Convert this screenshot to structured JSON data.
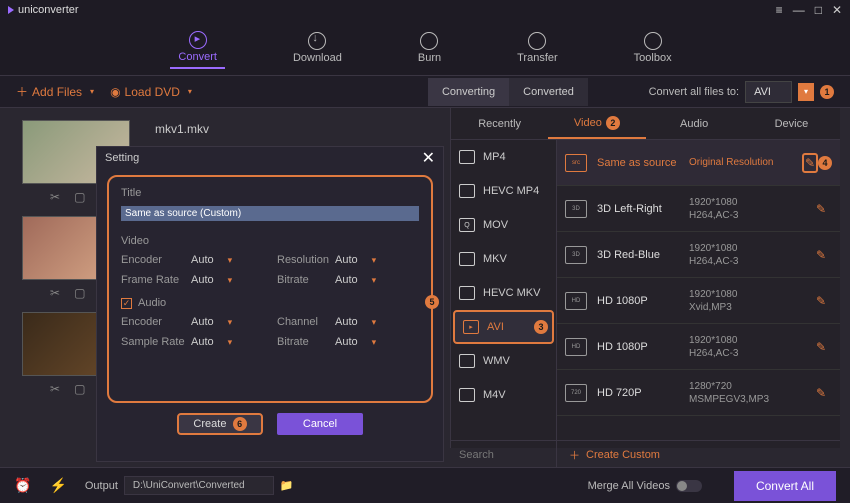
{
  "app": {
    "name": "uniconverter"
  },
  "window_controls": [
    "≡",
    "—",
    "□",
    "✕"
  ],
  "mainnav": [
    {
      "label": "Convert",
      "active": true
    },
    {
      "label": "Download",
      "active": false
    },
    {
      "label": "Burn",
      "active": false
    },
    {
      "label": "Transfer",
      "active": false
    },
    {
      "label": "Toolbox",
      "active": false
    }
  ],
  "toolbar": {
    "add_files": "Add Files",
    "load_dvd": "Load DVD",
    "tabs": {
      "converting": "Converting",
      "converted": "Converted"
    },
    "convert_all_label": "Convert all files to:",
    "format_value": "AVI"
  },
  "badges": {
    "b1": "1",
    "b2": "2",
    "b3": "3",
    "b4": "4",
    "b5": "5",
    "b6": "6"
  },
  "files": [
    {
      "name": "mkv1.mkv"
    }
  ],
  "setting": {
    "title": "Setting",
    "title_label": "Title",
    "title_value": "Same as source (Custom)",
    "video_label": "Video",
    "audio_label": "Audio",
    "fields": {
      "encoder": "Encoder",
      "resolution": "Resolution",
      "frame_rate": "Frame Rate",
      "bitrate": "Bitrate",
      "channel": "Channel",
      "sample_rate": "Sample Rate"
    },
    "auto": "Auto",
    "create": "Create",
    "cancel": "Cancel"
  },
  "format_panel": {
    "tabs": {
      "recently": "Recently",
      "video": "Video",
      "audio": "Audio",
      "device": "Device"
    },
    "formats": [
      "MP4",
      "HEVC MP4",
      "MOV",
      "MKV",
      "HEVC MKV",
      "AVI",
      "WMV",
      "M4V"
    ],
    "active_format": "AVI",
    "resolutions": [
      {
        "name": "Same as source",
        "res": "Original Resolution",
        "codec": "",
        "active": true
      },
      {
        "name": "3D Left-Right",
        "res": "1920*1080",
        "codec": "H264,AC-3"
      },
      {
        "name": "3D Red-Blue",
        "res": "1920*1080",
        "codec": "H264,AC-3"
      },
      {
        "name": "HD 1080P",
        "res": "1920*1080",
        "codec": "Xvid,MP3"
      },
      {
        "name": "HD 1080P",
        "res": "1920*1080",
        "codec": "H264,AC-3"
      },
      {
        "name": "HD 720P",
        "res": "1280*720",
        "codec": "MSMPEGV3,MP3"
      }
    ],
    "search_placeholder": "Search",
    "create_custom": "Create Custom"
  },
  "bottom": {
    "output_label": "Output",
    "output_path": "D:\\UniConvert\\Converted",
    "merge_label": "Merge All Videos",
    "convert_all": "Convert All"
  }
}
